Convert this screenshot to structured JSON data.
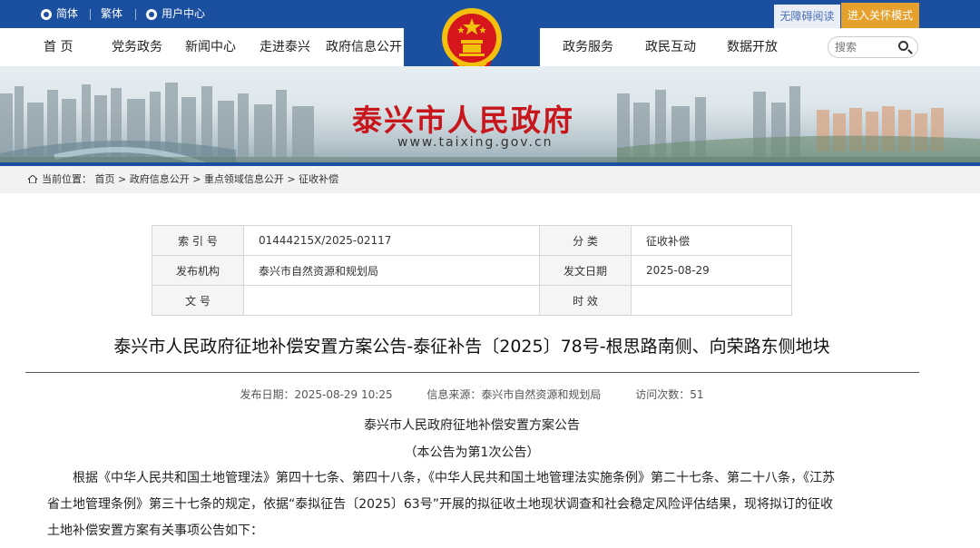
{
  "topbar": {
    "simplified": "简体",
    "traditional": "繁体",
    "user_center": "用户中心",
    "accessibility": "无障碍阅读",
    "elder_mode": "进入关怀模式"
  },
  "nav": {
    "items": [
      "首  页",
      "党务政务",
      "新闻中心",
      "走进泰兴",
      "政府信息公开",
      "政务服务",
      "政民互动",
      "数据开放"
    ],
    "search_placeholder": "搜索"
  },
  "banner": {
    "title": "泰兴市人民政府",
    "url": "www.taixing.gov.cn"
  },
  "breadcrumb": {
    "label": "当前位置：",
    "path": "首页 > 政府信息公开 > 重点领域信息公开 > 征收补偿"
  },
  "meta_table": [
    {
      "k1": "索 引 号",
      "v1": "01444215X/2025-02117",
      "k2": "分    类",
      "v2": "征收补偿"
    },
    {
      "k1": "发布机构",
      "v1": "泰兴市自然资源和规划局",
      "k2": "发文日期",
      "v2": "2025-08-29"
    },
    {
      "k1": "文    号",
      "v1": "",
      "k2": "时    效",
      "v2": ""
    }
  ],
  "article": {
    "title": "泰兴市人民政府征地补偿安置方案公告-泰征补告〔2025〕78号-根思路南侧、向荣路东侧地块",
    "publish_date": "发布日期：2025-08-29 10:25",
    "source": "信息来源：泰兴市自然资源和规划局",
    "visits": "访问次数：51",
    "heading": "泰兴市人民政府征地补偿安置方案公告",
    "subheading": "（本公告为第1次公告）",
    "para1_line1": "根据《中华人民共和国土地管理法》第四十七条、第四十八条，《中华人民共和国土地管理法实施条例》第二十七条、第二十八条，《江苏",
    "para1_line2": "省土地管理条例》第三十七条的规定，依据“泰拟征告〔2025〕63号”开展的拟征收土地现状调查和社会稳定风险评估结果，现将拟订的征收",
    "para1_line3": "土地补偿安置方案有关事项公告如下："
  },
  "colors": {
    "brand_blue": "#1b4fa0",
    "title_red": "#c8161d",
    "elder_orange": "#e6a12d"
  }
}
